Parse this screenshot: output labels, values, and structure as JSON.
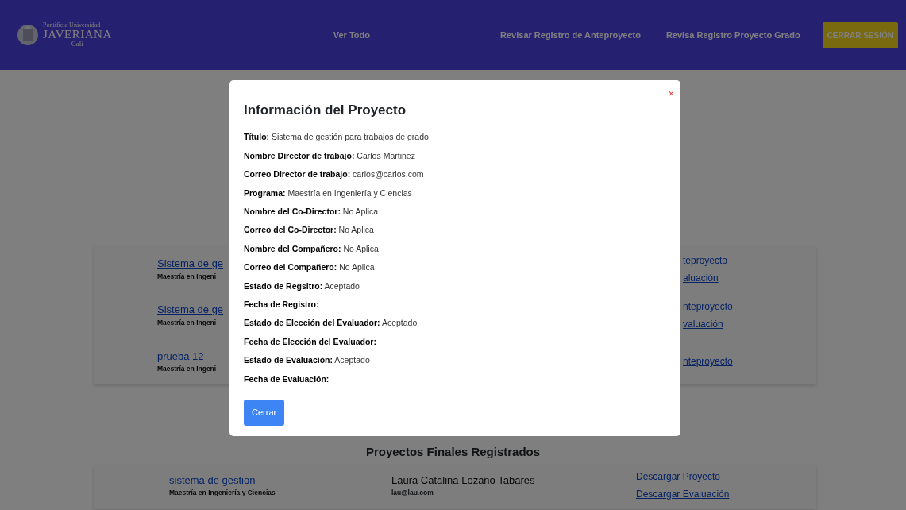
{
  "navbar": {
    "logo": {
      "line_1": "Pontificia Universidad",
      "line_2": "JAVERIANA",
      "line_3": "Cali"
    },
    "links": [
      "Ver Todo",
      "Revisar Registro de Anteproyecto",
      "Revisa Registro Proyecto Grado"
    ],
    "logout_button": "CERRAR SESIÓN"
  },
  "preliminary_projects": [
    {
      "title": "Sistema de ge",
      "program": "Maestría en Ingeni",
      "links": [
        "teproyecto",
        "aluación"
      ]
    },
    {
      "title": "Sistema de ge",
      "program": "Maestría en Ingeni",
      "links": [
        "nteproyecto",
        "valuación"
      ]
    },
    {
      "title": "prueba 12",
      "program": "Maestría en Ingeni",
      "links": [
        "nteproyecto"
      ]
    }
  ],
  "final_projects": {
    "heading": "Proyectos Finales Registrados",
    "rows": [
      {
        "title": "sistema de gestion",
        "program": "Maestría en Ingeniería y Ciencias",
        "student": "Laura Catalina Lozano Tabares",
        "email": "lau@lau.com",
        "links": [
          "Descargar Proyecto",
          "Descargar Evaluación"
        ]
      }
    ]
  },
  "modal": {
    "title": "Información del Proyecto",
    "close": "×",
    "button": "Cerrar",
    "fields": [
      {
        "label": "Título:",
        "value": "Sistema de gestión para trabajos de grado"
      },
      {
        "label": "Nombre Director de trabajo:",
        "value": "Carlos Martinez"
      },
      {
        "label": "Correo Director de trabajo:",
        "value": "carlos@carlos.com"
      },
      {
        "label": "Programa:",
        "value": "Maestría en Ingeniería y Ciencias"
      },
      {
        "label": "Nombre del Co-Director:",
        "value": "No Aplica"
      },
      {
        "label": "Correo del Co-Director:",
        "value": "No Aplica"
      },
      {
        "label": "Nombre del Compañero:",
        "value": "No Aplica"
      },
      {
        "label": "Correo del Compañero:",
        "value": "No Aplica"
      },
      {
        "label": "Estado de Regsitro:",
        "value": "Aceptado"
      },
      {
        "label": "Fecha de Registro:"
      },
      {
        "label": "Estado de Elección del Evaluador:",
        "value": "Aceptado"
      },
      {
        "label": "Fecha de Elección del Evaluador:"
      },
      {
        "label": "Estado de Evaluación:",
        "value": "Aceptado"
      },
      {
        "label": "Fecha de Evaluación:"
      }
    ]
  }
}
